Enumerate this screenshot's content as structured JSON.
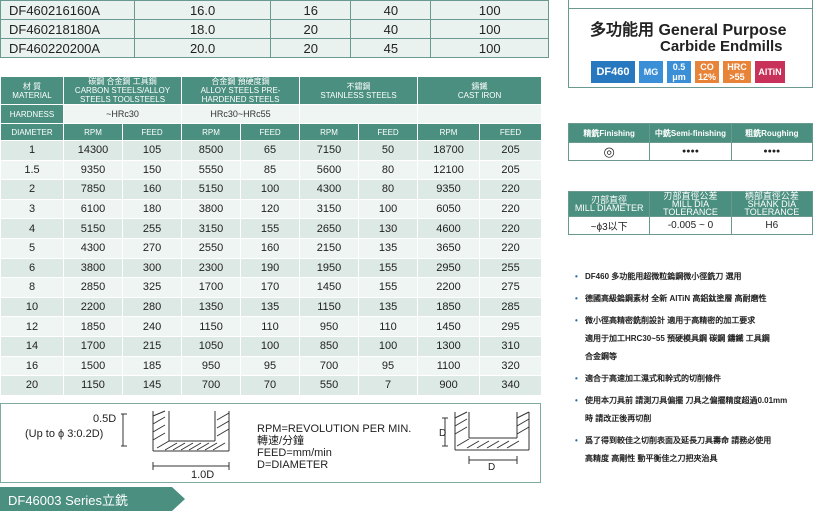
{
  "size_rows": [
    {
      "code": "DF460216160A",
      "a": "16.0",
      "b": "16",
      "c": "40",
      "d": "100"
    },
    {
      "code": "DF460218180A",
      "a": "18.0",
      "b": "20",
      "c": "40",
      "d": "100"
    },
    {
      "code": "DF460220200A",
      "a": "20.0",
      "b": "20",
      "c": "45",
      "d": "100"
    }
  ],
  "speed_table": {
    "material_label": "材 質\nMATERIAL",
    "groups": [
      "碳鋼 合金鋼 工具鋼\nCARBON STEELS/ALLOY STEELS TOOLSTEELS",
      "合金鋼 預硬度鋼\nALLOY STEELS PRE-HARDENED STEELS",
      "不鏽鋼\nSTAINLESS STEELS",
      "鑄鐵\nCAST IRON"
    ],
    "hardness_label": "HARDNESS",
    "hardness": [
      "~HRc30",
      "HRc30~HRc55",
      "",
      ""
    ],
    "diameter_label": "DIAMETER",
    "rpm_label": "RPM",
    "feed_label": "FEED",
    "rows": [
      [
        "1",
        "14300",
        "105",
        "8500",
        "65",
        "7150",
        "50",
        "18700",
        "205"
      ],
      [
        "1.5",
        "9350",
        "150",
        "5550",
        "85",
        "5600",
        "80",
        "12100",
        "205"
      ],
      [
        "2",
        "7850",
        "160",
        "5150",
        "100",
        "4300",
        "80",
        "9350",
        "220"
      ],
      [
        "3",
        "6100",
        "180",
        "3800",
        "120",
        "3150",
        "100",
        "6050",
        "220"
      ],
      [
        "4",
        "5150",
        "255",
        "3150",
        "155",
        "2650",
        "130",
        "4600",
        "220"
      ],
      [
        "5",
        "4300",
        "270",
        "2550",
        "160",
        "2150",
        "135",
        "3650",
        "220"
      ],
      [
        "6",
        "3800",
        "300",
        "2300",
        "190",
        "1950",
        "155",
        "2950",
        "255"
      ],
      [
        "8",
        "2850",
        "325",
        "1700",
        "170",
        "1450",
        "155",
        "2200",
        "275"
      ],
      [
        "10",
        "2200",
        "280",
        "1350",
        "135",
        "1150",
        "135",
        "1850",
        "285"
      ],
      [
        "12",
        "1850",
        "240",
        "1150",
        "110",
        "950",
        "110",
        "1450",
        "295"
      ],
      [
        "14",
        "1700",
        "215",
        "1050",
        "100",
        "850",
        "100",
        "1300",
        "310"
      ],
      [
        "16",
        "1500",
        "185",
        "950",
        "95",
        "700",
        "95",
        "1100",
        "320"
      ],
      [
        "20",
        "1150",
        "145",
        "700",
        "70",
        "550",
        "7",
        "900",
        "340"
      ]
    ]
  },
  "diagram": {
    "depth_label": "0.5D",
    "up_to_label": "(Up to ϕ 3:0.2D)",
    "width_label": "1.0D",
    "legend": [
      "RPM=REVOLUTION PER MIN.",
      "轉速/分鐘",
      "FEED=mm/min",
      "D=DIAMETER"
    ],
    "d_label": "D"
  },
  "series_label": "DF46003 Series立銑",
  "title": {
    "line1": "多功能用 General Purpose",
    "line2": "Carbide Endmills",
    "badges": [
      {
        "text": "DF460",
        "color": "#2878c0"
      },
      {
        "text": "MG",
        "color": "#3a8fd6"
      },
      {
        "text": "0.5\nμm",
        "color": "#3a8fd6"
      },
      {
        "text": "CO\n12%",
        "color": "#e8843a"
      },
      {
        "text": "HRC\n>55",
        "color": "#e8843a"
      },
      {
        "text": "AlTiN",
        "color": "#c8315a"
      }
    ]
  },
  "finish_table": {
    "headers": [
      "精銑Finishing",
      "中銑Semi-finishing",
      "粗銑Roughing"
    ],
    "values": [
      "◎",
      "●●●●",
      "●●●●"
    ]
  },
  "tolerance_table": {
    "headers": [
      "刃部直徑\nMILL DIAMETER",
      "刃部直徑公差\nMILL DIA TOLERANCE",
      "柄部直徑公差\nSHANK DIA TOLERANCE"
    ],
    "values": [
      "~ϕ3以下",
      "-0.005 ~ 0",
      "H6"
    ]
  },
  "notes": [
    [
      "DF460 多功能用超微粒鎢鋼微小徑銑刀  選用"
    ],
    [
      "德國高級鎢鋼素材 全新 AlTiN 高鋁鈦塗層 高耐磨性"
    ],
    [
      "微小徑高精密銑削設計 適用于高精密的加工要求",
      "適用于加工HRC30~55 預硬模具鋼  碳鋼  鑄鐵  工具鋼",
      "合金鋼等"
    ],
    [
      "適合于高速加工濕式和幹式的切削條件"
    ],
    [
      "使用本刀具前 請測刀具偏擺 刀具之偏擺精度超過0.01mm",
      "時  請改正後再切削"
    ],
    [
      "爲了得到較佳之切削表面及延長刀具壽命  請務必使用",
      "高精度  高剛性  動平衡佳之刀把夾治具"
    ]
  ]
}
